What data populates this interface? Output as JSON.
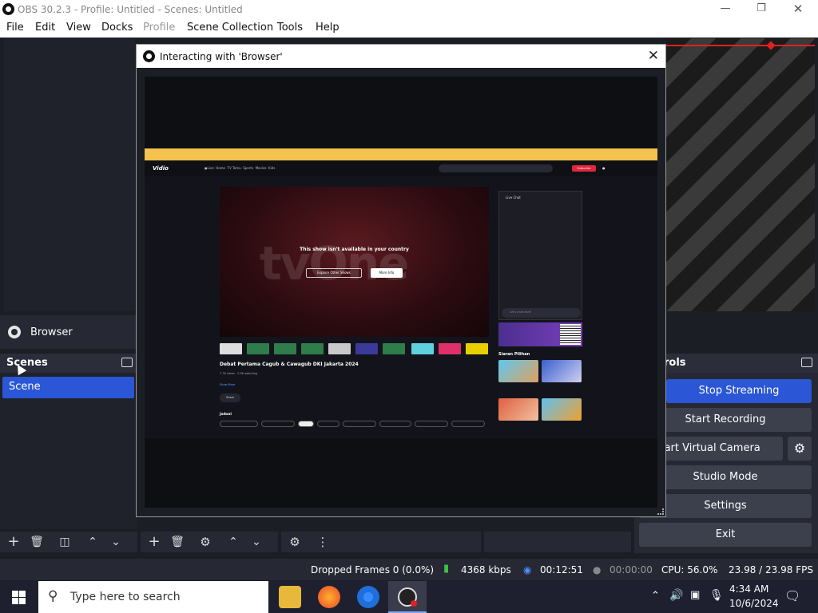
{
  "window": {
    "title": "OBS 30.2.3 - Profile: Untitled - Scenes: Untitled"
  },
  "menu": {
    "file": "File",
    "edit": "Edit",
    "view": "View",
    "docks": "Docks",
    "profile": "Profile",
    "scene_collection": "Scene Collection",
    "tools": "Tools",
    "help": "Help"
  },
  "sources": {
    "item": "Browser"
  },
  "scenes": {
    "header": "Scenes",
    "items": [
      "Scene"
    ]
  },
  "controls": {
    "header": "rols",
    "stop_streaming": "Stop Streaming",
    "start_recording": "Start Recording",
    "start_virtual_camera": "Start Virtual Camera",
    "studio_mode": "Studio Mode",
    "settings": "Settings",
    "exit": "Exit"
  },
  "status": {
    "dropped_frames": "Dropped Frames 0 (0.0%)",
    "bitrate": "4368 kbps",
    "stream_time": "00:12:51",
    "record_time": "00:00:00",
    "cpu": "CPU: 56.0%",
    "fps": "23.98 / 23.98 FPS"
  },
  "dialog": {
    "title": "Interacting with 'Browser'"
  },
  "website": {
    "brand": "Vidio",
    "player_watermark": "tvOne",
    "unavailable_msg": "This show isn't available in your country",
    "explore_btn": "Explore Other Shows",
    "more_btn": "More Info",
    "video_title": "Debat Pertama Cagub & Cawagub DKI Jakarta 2024",
    "meta": "7.7K views · 2.5K watching",
    "show_more": "Show More",
    "share": "Share",
    "schedule_label": "Jadwal",
    "live_chat": "Live Chat",
    "chat_placeholder": "Let's chat here!",
    "siaran_pilihan": "Siaran Pilihan",
    "subscribe": "Subscribe"
  },
  "taskbar": {
    "search_placeholder": "Type here to search",
    "time": "4:34 AM",
    "date": "10/6/2024"
  },
  "colors": {
    "accent": "#2b57d6",
    "stop_red": "#e02020"
  }
}
